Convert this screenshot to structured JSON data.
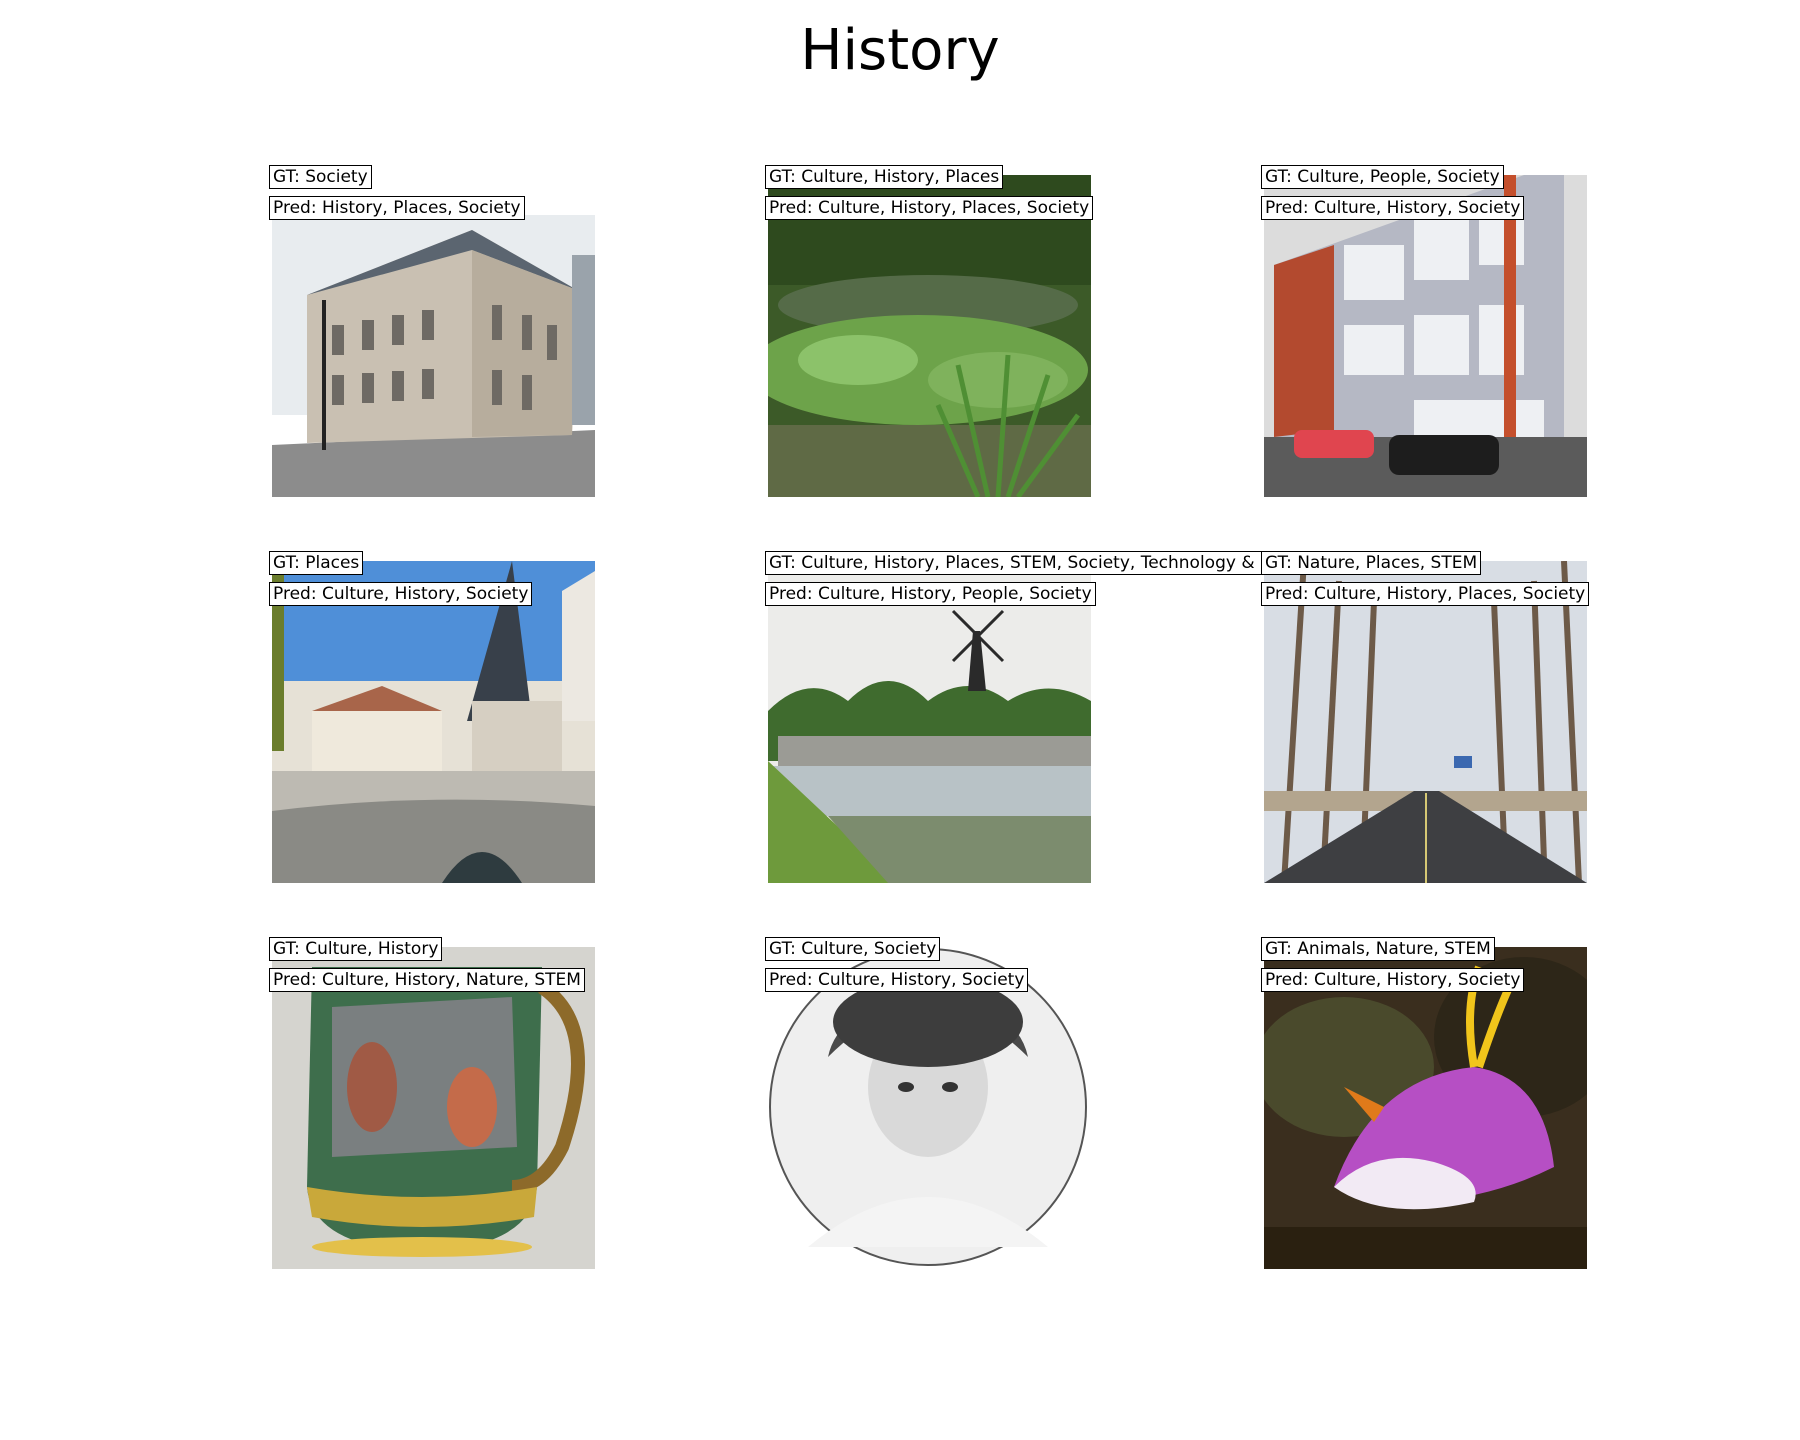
{
  "title": "History",
  "panels": [
    {
      "gt": "GT: Society",
      "pred": "Pred: History, Places, Society",
      "scene": "stone-building-street-corner"
    },
    {
      "gt": "GT: Culture, History, Places",
      "pred": "Pred: Culture, History, Places, Society",
      "scene": "pond-with-lily-pads"
    },
    {
      "gt": "GT: Culture, People, Society",
      "pred": "Pred: Culture, History, Society",
      "scene": "modern-building-parked-cars"
    },
    {
      "gt": "GT: Places",
      "pred": "Pred: Culture, History, Society",
      "scene": "village-church-stone-bridge"
    },
    {
      "gt": "GT: Culture, History, Places, STEM, Society, Technology & Eng",
      "pred": "Pred: Culture, History, People, Society",
      "scene": "windmill-canal-lock"
    },
    {
      "gt": "GT: Nature, Places, STEM",
      "pred": "Pred: Culture, History, Places, Society",
      "scene": "tree-lined-road"
    },
    {
      "gt": "GT: Culture, History",
      "pred": "Pred: Culture, History, Nature, STEM",
      "scene": "majolica-jug"
    },
    {
      "gt": "GT: Culture, Society",
      "pred": "Pred: Culture, History, Society",
      "scene": "vintage-portrait-woman"
    },
    {
      "gt": "GT: Animals, Nature, STEM",
      "pred": "Pred: Culture, History, Society",
      "scene": "purple-nudibranch"
    }
  ]
}
